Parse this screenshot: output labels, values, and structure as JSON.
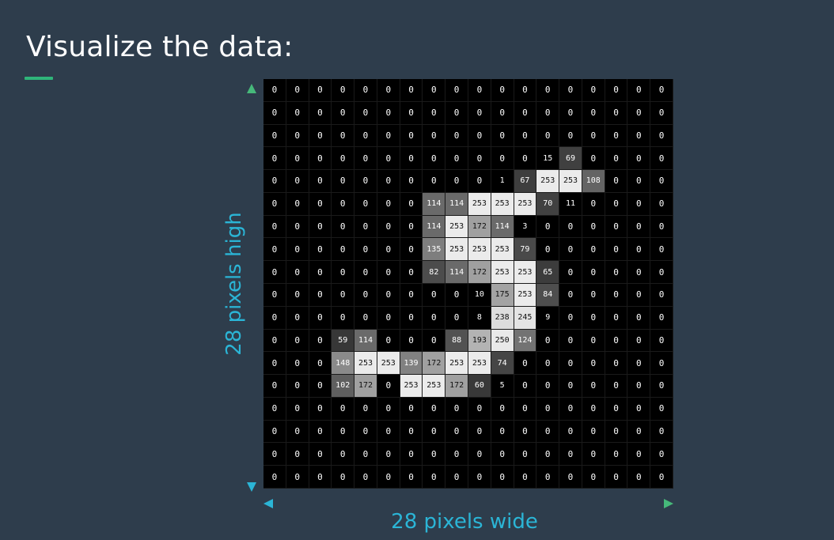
{
  "title": "Visualize the data:",
  "colors": {
    "background": "#2e3d4c",
    "accent_rule": "#2fb57a",
    "arrow_gradient": [
      "#2bb5d6",
      "#46b97a"
    ],
    "label_text": "#2bb5d6"
  },
  "labels": {
    "height": "28 pixels high",
    "width": "28 pixels wide"
  },
  "grid": {
    "rows": [
      [
        0,
        0,
        0,
        0,
        0,
        0,
        0,
        0,
        0,
        0,
        0,
        0,
        0,
        0,
        0,
        0,
        0,
        0
      ],
      [
        0,
        0,
        0,
        0,
        0,
        0,
        0,
        0,
        0,
        0,
        0,
        0,
        0,
        0,
        0,
        0,
        0,
        0
      ],
      [
        0,
        0,
        0,
        0,
        0,
        0,
        0,
        0,
        0,
        0,
        0,
        0,
        0,
        0,
        0,
        0,
        0,
        0
      ],
      [
        0,
        0,
        0,
        0,
        0,
        0,
        0,
        0,
        0,
        0,
        0,
        0,
        15,
        69,
        0,
        0,
        0,
        0
      ],
      [
        0,
        0,
        0,
        0,
        0,
        0,
        0,
        0,
        0,
        0,
        1,
        67,
        253,
        253,
        108,
        0,
        0,
        0
      ],
      [
        0,
        0,
        0,
        0,
        0,
        0,
        0,
        114,
        114,
        253,
        253,
        253,
        70,
        11,
        0,
        0,
        0,
        0
      ],
      [
        0,
        0,
        0,
        0,
        0,
        0,
        0,
        114,
        253,
        172,
        114,
        3,
        0,
        0,
        0,
        0,
        0,
        0
      ],
      [
        0,
        0,
        0,
        0,
        0,
        0,
        0,
        135,
        253,
        253,
        253,
        79,
        0,
        0,
        0,
        0,
        0,
        0
      ],
      [
        0,
        0,
        0,
        0,
        0,
        0,
        0,
        82,
        114,
        172,
        253,
        253,
        65,
        0,
        0,
        0,
        0,
        0
      ],
      [
        0,
        0,
        0,
        0,
        0,
        0,
        0,
        0,
        0,
        10,
        175,
        253,
        84,
        0,
        0,
        0,
        0,
        0
      ],
      [
        0,
        0,
        0,
        0,
        0,
        0,
        0,
        0,
        0,
        8,
        238,
        245,
        9,
        0,
        0,
        0,
        0,
        0
      ],
      [
        0,
        0,
        0,
        59,
        114,
        0,
        0,
        0,
        88,
        193,
        250,
        124,
        0,
        0,
        0,
        0,
        0,
        0
      ],
      [
        0,
        0,
        0,
        148,
        253,
        253,
        139,
        172,
        253,
        253,
        74,
        0,
        0,
        0,
        0,
        0,
        0,
        0
      ],
      [
        0,
        0,
        0,
        102,
        172,
        0,
        253,
        253,
        172,
        60,
        5,
        0,
        0,
        0,
        0,
        0,
        0,
        0
      ],
      [
        0,
        0,
        0,
        0,
        0,
        0,
        0,
        0,
        0,
        0,
        0,
        0,
        0,
        0,
        0,
        0,
        0,
        0
      ],
      [
        0,
        0,
        0,
        0,
        0,
        0,
        0,
        0,
        0,
        0,
        0,
        0,
        0,
        0,
        0,
        0,
        0,
        0
      ],
      [
        0,
        0,
        0,
        0,
        0,
        0,
        0,
        0,
        0,
        0,
        0,
        0,
        0,
        0,
        0,
        0,
        0,
        0
      ],
      [
        0,
        0,
        0,
        0,
        0,
        0,
        0,
        0,
        0,
        0,
        0,
        0,
        0,
        0,
        0,
        0,
        0,
        0
      ]
    ]
  }
}
